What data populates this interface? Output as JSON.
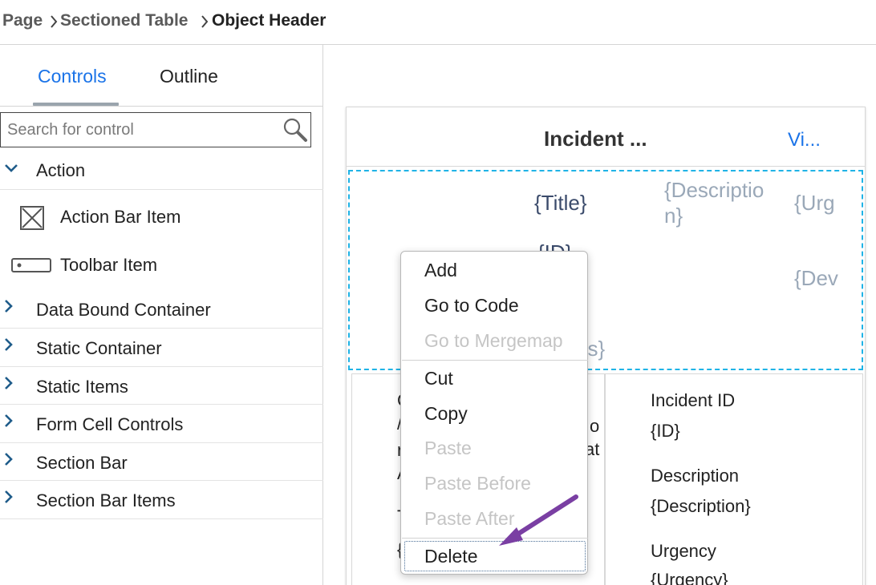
{
  "breadcrumb": {
    "items": [
      "Page",
      "Sectioned Table",
      "Object Header"
    ]
  },
  "left_panel": {
    "tabs": [
      {
        "label": "Controls",
        "active": true
      },
      {
        "label": "Outline",
        "active": false
      }
    ],
    "search": {
      "placeholder": "Search for control",
      "value": ""
    },
    "tree": {
      "action_group": {
        "label": "Action",
        "expanded": true
      },
      "action_items": [
        {
          "label": "Action Bar Item",
          "icon": "action-bar-item-icon"
        },
        {
          "label": "Toolbar Item",
          "icon": "toolbar-item-icon"
        }
      ],
      "groups": [
        {
          "label": "Data Bound Container",
          "expanded": false
        },
        {
          "label": "Static Container",
          "expanded": false
        },
        {
          "label": "Static Items",
          "expanded": false
        },
        {
          "label": "Form Cell Controls",
          "expanded": false
        },
        {
          "label": "Section Bar",
          "expanded": false
        },
        {
          "label": "Section Bar Items",
          "expanded": false
        }
      ]
    }
  },
  "preview": {
    "title": "Incident ...",
    "link": "Vi...",
    "object_header": {
      "title": "{Title}",
      "description_line1": "{Descriptio",
      "description_line2": "n}",
      "urgency": "{Urg",
      "id": "{ID}",
      "device": "{Dev",
      "status": "us}"
    },
    "left_fragments": [
      "C",
      "/",
      "r",
      "A",
      "T",
      "{",
      "o",
      "at"
    ],
    "key_values": [
      {
        "label": "Incident ID",
        "value": "{ID}"
      },
      {
        "label": "Description",
        "value": "{Description}"
      },
      {
        "label": "Urgency",
        "value": "{Urgency}"
      }
    ]
  },
  "context_menu": {
    "items": [
      {
        "label": "Add",
        "enabled": true
      },
      {
        "label": "Go to Code",
        "enabled": true
      },
      {
        "label": "Go to Mergemap",
        "enabled": false
      },
      {
        "label": "Cut",
        "enabled": true
      },
      {
        "label": "Copy",
        "enabled": true
      },
      {
        "label": "Paste",
        "enabled": false
      },
      {
        "label": "Paste Before",
        "enabled": false
      },
      {
        "label": "Paste After",
        "enabled": false
      },
      {
        "label": "Delete",
        "enabled": true
      }
    ]
  },
  "colors": {
    "accent": "#1a73e8",
    "selection_dashed": "#1fb3e6",
    "annotation_arrow": "#7a3fa3",
    "chevron": "#1f5c8a"
  }
}
